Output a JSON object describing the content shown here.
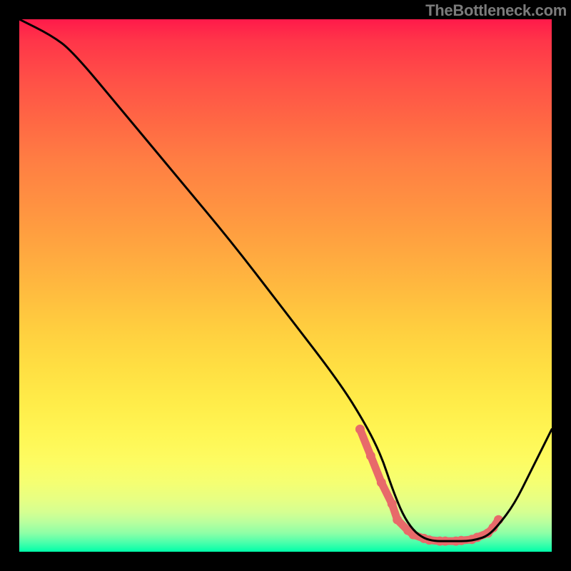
{
  "attribution": "TheBottleneck.com",
  "chart_data": {
    "type": "line",
    "title": "",
    "xlabel": "",
    "ylabel": "",
    "xlim": [
      0,
      100
    ],
    "ylim": [
      0,
      100
    ],
    "series": [
      {
        "name": "curve",
        "x": [
          0,
          6,
          10,
          20,
          30,
          40,
          50,
          60,
          65,
          68,
          70,
          72,
          74,
          76,
          78,
          80,
          82,
          84,
          86,
          88,
          90,
          93,
          96,
          100
        ],
        "y": [
          100,
          97,
          94,
          82,
          70,
          58,
          45,
          32,
          24,
          18,
          12,
          7,
          4,
          2.5,
          2,
          2,
          2,
          2,
          2.3,
          3,
          5,
          9,
          15,
          23
        ]
      }
    ],
    "markers": {
      "name": "highlight",
      "color": "#e86a6a",
      "x": [
        64,
        66,
        68,
        70,
        71,
        73,
        74,
        76,
        77,
        79,
        80,
        82,
        83,
        85,
        86,
        88,
        89,
        90
      ],
      "y": [
        23,
        18,
        13,
        9,
        6,
        4,
        3.2,
        2.5,
        2.2,
        2,
        2,
        2,
        2.1,
        2.3,
        2.7,
        3.5,
        4.5,
        6
      ]
    },
    "grid": false,
    "legend": false
  }
}
